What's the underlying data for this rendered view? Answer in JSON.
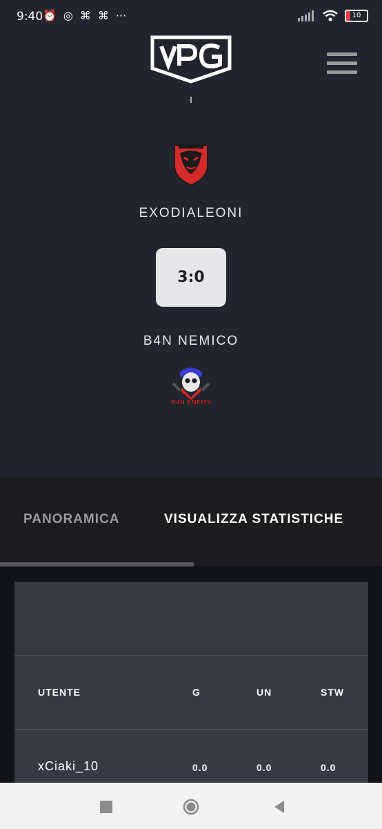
{
  "status_bar": {
    "time": "9:40",
    "battery": "10"
  },
  "header": {
    "logo_text": "VPG",
    "subtitle": "I"
  },
  "match": {
    "home_team": "EXODIALEONI",
    "away_team": "B4N NEMICO",
    "score": "3:0",
    "away_logo_text": "B4N ENEMY"
  },
  "tabs": [
    {
      "label": "PANORAMICA",
      "active": false
    },
    {
      "label": "VISUALIZZA STATISTICHE",
      "active": true
    }
  ],
  "stats": {
    "columns": [
      "UTENTE",
      "G",
      "UN",
      "STW"
    ],
    "rows": [
      {
        "user": "xCiaki_10",
        "g": "0.0",
        "un": "0.0",
        "stw": "0.0"
      }
    ]
  },
  "colors": {
    "background": "#23252e",
    "accent_red": "#d42a2a",
    "score_box": "#e6e6e8"
  },
  "icons": [
    "alarm-icon",
    "whatsapp-icon",
    "discord-icon",
    "signal-icon",
    "wifi-icon",
    "battery-icon",
    "menu-icon"
  ]
}
